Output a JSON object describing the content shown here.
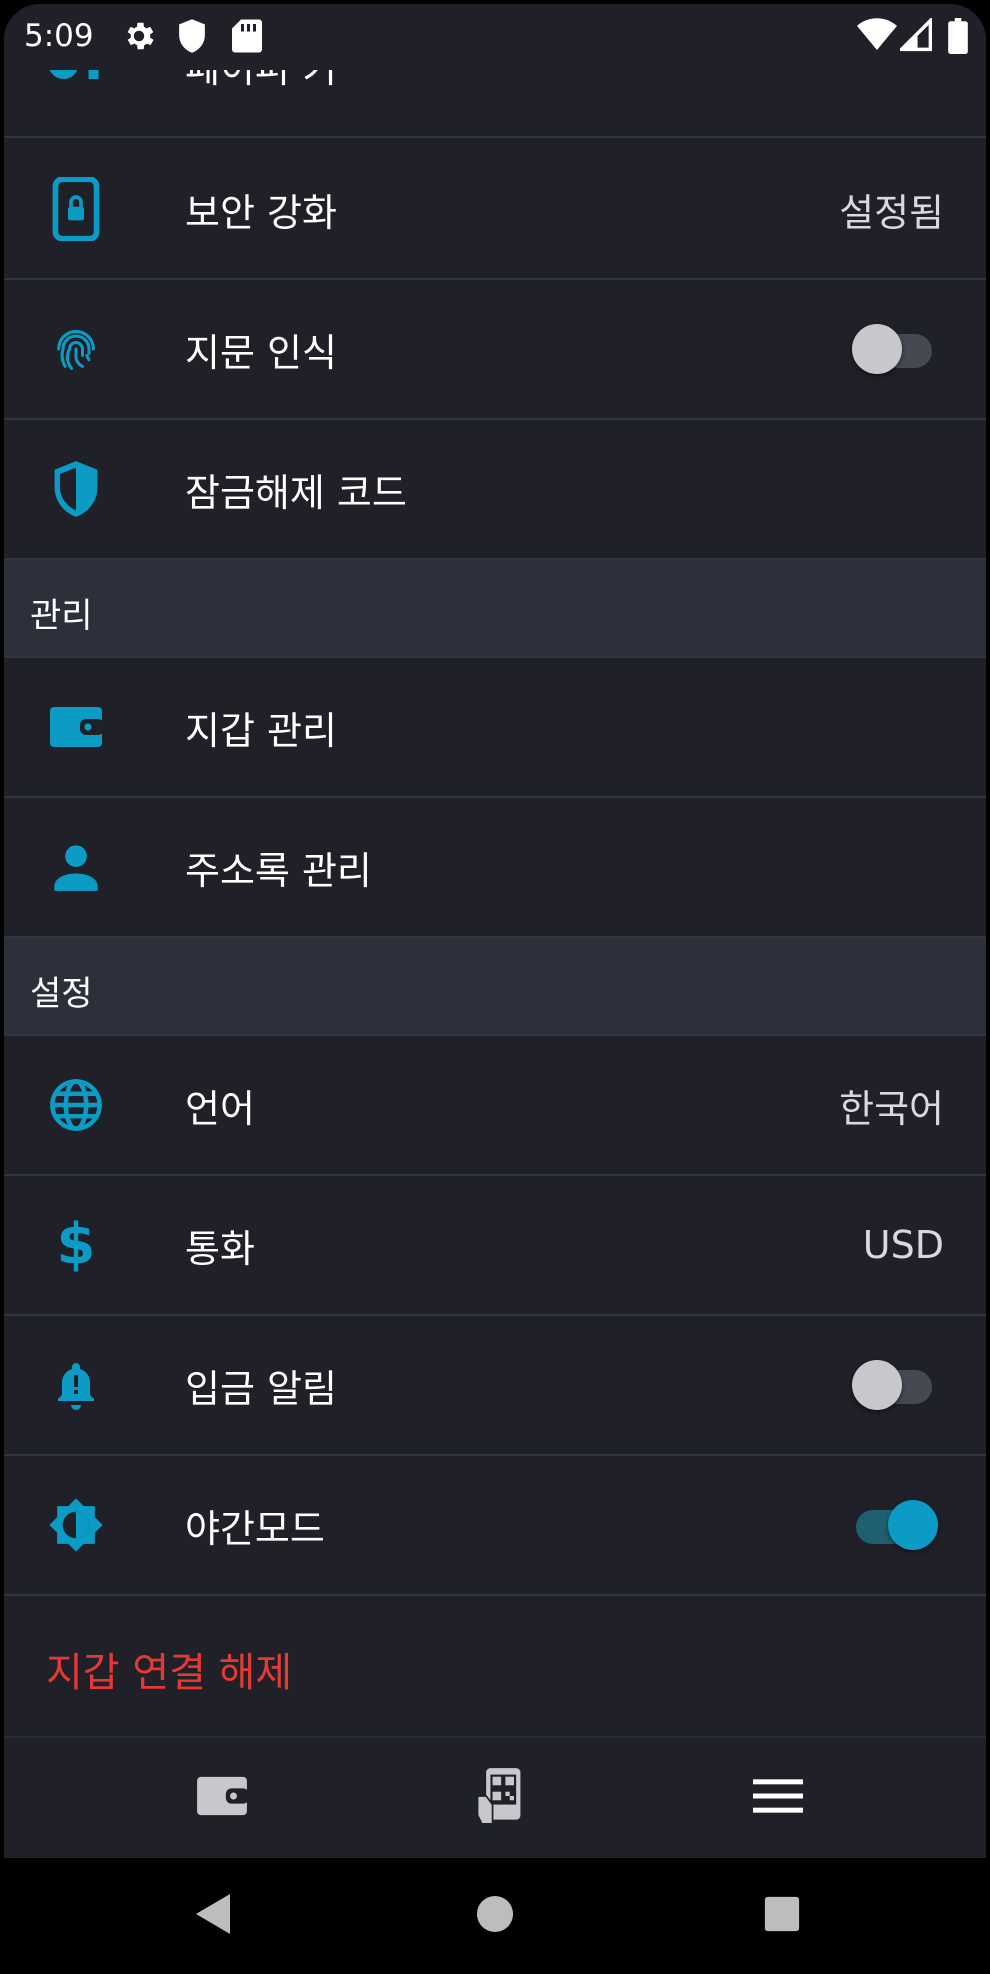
{
  "status_bar": {
    "time": "5:09"
  },
  "partial_row": {
    "label": "페이퍼 키"
  },
  "security": {
    "items": [
      {
        "label": "보안 강화",
        "value": "설정됨",
        "icon": "phone-lock-icon"
      },
      {
        "label": "지문 인식",
        "toggle": "off",
        "icon": "fingerprint-icon"
      },
      {
        "label": "잠금해제 코드",
        "icon": "shield-icon"
      }
    ]
  },
  "management": {
    "header": "관리",
    "items": [
      {
        "label": "지갑 관리",
        "icon": "wallet-icon"
      },
      {
        "label": "주소록 관리",
        "icon": "person-icon"
      }
    ]
  },
  "settings": {
    "header": "설정",
    "items": [
      {
        "label": "언어",
        "value": "한국어",
        "icon": "globe-icon"
      },
      {
        "label": "통화",
        "value": "USD",
        "icon": "dollar-icon"
      },
      {
        "label": "입금 알림",
        "toggle": "off",
        "icon": "bell-icon"
      },
      {
        "label": "야간모드",
        "toggle": "on",
        "icon": "brightness-icon"
      }
    ]
  },
  "disconnect": {
    "label": "지갑 연결 해제"
  },
  "colors": {
    "accent": "#0b9bc5",
    "danger": "#e53935",
    "background": "#1f2028",
    "section": "#2d2f3b"
  },
  "bottom_nav": [
    {
      "icon": "wallet-icon"
    },
    {
      "icon": "qr-scan-icon"
    },
    {
      "icon": "menu-icon"
    }
  ]
}
